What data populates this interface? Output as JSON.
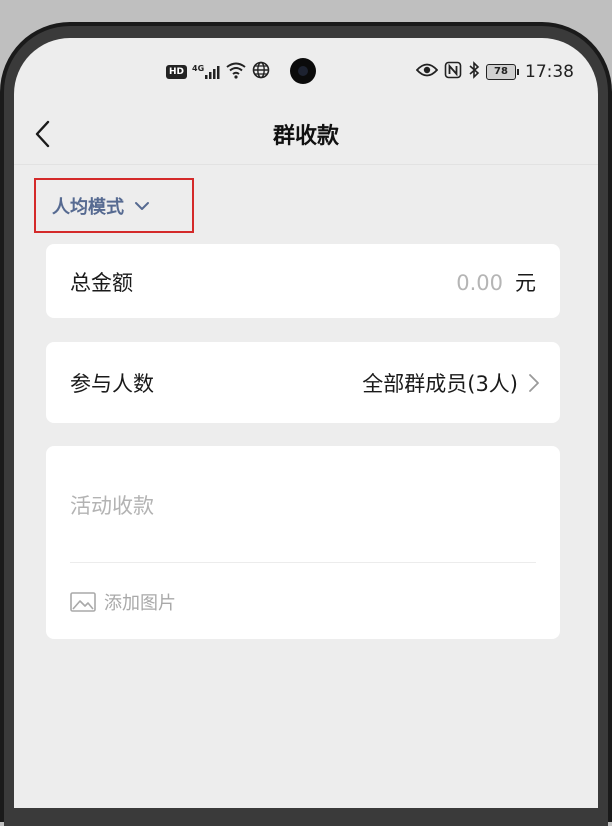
{
  "statusbar": {
    "network_badge": "HD",
    "network_type": "4G",
    "battery": "78",
    "time": "17:38"
  },
  "navbar": {
    "title": "群收款"
  },
  "mode": {
    "label": "人均模式"
  },
  "total": {
    "label": "总金额",
    "value": "0.00",
    "unit": "元"
  },
  "participants": {
    "label": "参与人数",
    "value": "全部群成员(3人)"
  },
  "note": {
    "placeholder": "活动收款",
    "add_image_label": "添加图片"
  },
  "colors": {
    "accent_link": "#566a91",
    "highlight_box": "#d42a2a",
    "background": "#ededed",
    "card": "#ffffff",
    "placeholder": "#b3b3b3"
  }
}
